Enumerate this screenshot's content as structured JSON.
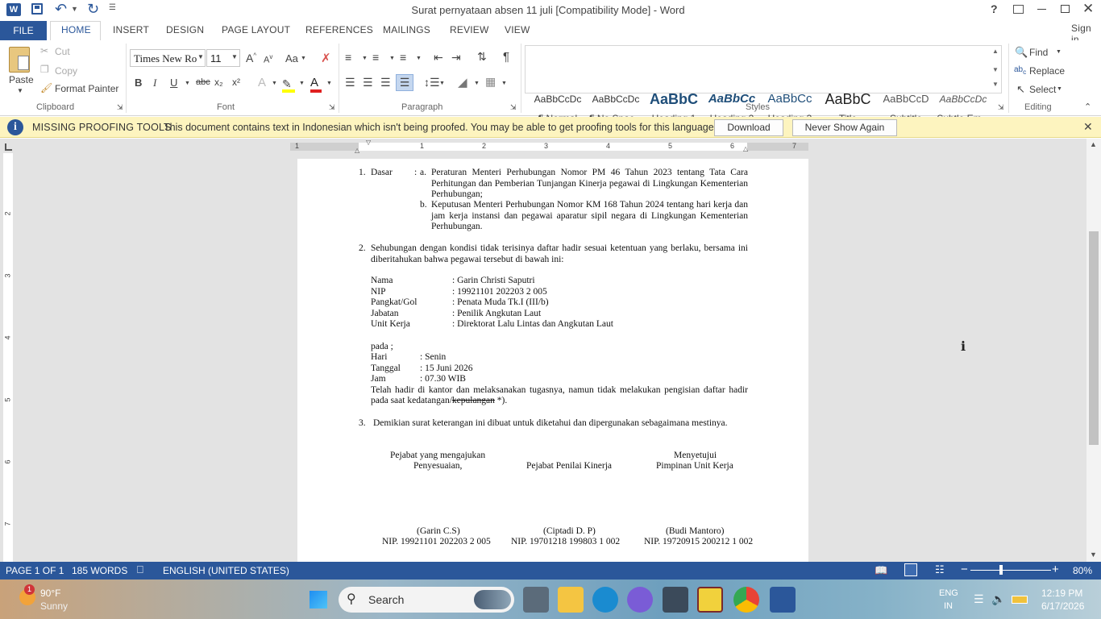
{
  "window": {
    "title": "Surat pernyataan absen 11 juli [Compatibility Mode] - Word",
    "help": "?"
  },
  "tabs": [
    "FILE",
    "HOME",
    "INSERT",
    "DESIGN",
    "PAGE LAYOUT",
    "REFERENCES",
    "MAILINGS",
    "REVIEW",
    "VIEW"
  ],
  "sign_in": "Sign in",
  "clipboard": {
    "paste": "Paste",
    "cut": "Cut",
    "copy": "Copy",
    "format_painter": "Format Painter",
    "label": "Clipboard"
  },
  "font": {
    "name": "Times New Ro",
    "size": "11",
    "label": "Font",
    "case": "Aa",
    "bold": "B",
    "italic": "I",
    "underline": "U",
    "strike": "abc",
    "sub": "x₂",
    "sup": "x²",
    "effects": "A",
    "color": "A"
  },
  "paragraph": {
    "label": "Paragraph",
    "pilcrow": "¶"
  },
  "styles": {
    "label": "Styles",
    "items": [
      {
        "preview": "AaBbCcDc",
        "name": "¶ Normal"
      },
      {
        "preview": "AaBbCcDc",
        "name": "¶ No Spac..."
      },
      {
        "preview": "AaBbC",
        "name": "Heading 1"
      },
      {
        "preview": "AaBbCc",
        "name": "Heading 2"
      },
      {
        "preview": "AaBbCc",
        "name": "Heading 3"
      },
      {
        "preview": "AaBbC",
        "name": "Title"
      },
      {
        "preview": "AaBbCcD",
        "name": "Subtitle"
      },
      {
        "preview": "AaBbCcDc",
        "name": "Subtle Em..."
      }
    ]
  },
  "editing": {
    "label": "Editing",
    "find": "Find",
    "replace": "Replace",
    "select": "Select"
  },
  "infobar": {
    "title": "MISSING PROOFING TOOLS",
    "message": "This document contains text in Indonesian which isn't being proofed. You may be able to get proofing tools for this language.",
    "download": "Download",
    "never": "Never Show Again"
  },
  "ruler": {
    "h": [
      "1",
      "1",
      "2",
      "3",
      "4",
      "5",
      "6",
      "7"
    ],
    "v": [
      "2",
      "3",
      "4",
      "5",
      "6",
      "7"
    ]
  },
  "doc": {
    "p1_num": "1.",
    "p1_label": "Dasar",
    "colon": ":",
    "p1a_l": "a.",
    "p1a": "Peraturan Menteri Perhubungan Nomor PM  46 Tahun 2023 tentang Tata Cara Perhitungan dan Pemberian Tunjangan Kinerja pegawai di Lingkungan Kementerian Perhubungan;",
    "p1b_l": "b.",
    "p1b": "Keputusan Menteri Perhubungan Nomor KM 168 Tahun 2024 tentang hari kerja dan jam kerja instansi dan pegawai aparatur sipil negara di Lingkungan Kementerian Perhubungan.",
    "p2_num": "2.",
    "p2": "Sehubungan dengan kondisi tidak terisinya daftar hadir sesuai ketentuan yang berlaku, bersama ini diberitahukan bahwa pegawai tersebut di bawah ini:",
    "fields": [
      {
        "k": "Nama",
        "v": ": Garin Christi Saputri"
      },
      {
        "k": "NIP",
        "v": ": 19921101 202203 2 005"
      },
      {
        "k": "Pangkat/Gol",
        "v": ": Penata Muda Tk.I (III/b)"
      },
      {
        "k": "Jabatan",
        "v": ": Penilik Angkutan Laut"
      },
      {
        "k": "Unit Kerja",
        "v": ": Direktorat Lalu Lintas dan Angkutan Laut"
      }
    ],
    "pada": "pada ;",
    "times": [
      {
        "k": "Hari",
        "v": ": Senin"
      },
      {
        "k": "Tanggal",
        "v": ": 15 Juni 2026"
      },
      {
        "k": "Jam",
        "v": ": 07.30 WIB"
      }
    ],
    "telah": "Telah hadir di kantor dan melaksanakan tugasnya, namun tidak melakukan pengisian daftar hadir",
    "pada_saat": "pada saat kedatangan/",
    "kepulangan": "kepulangan",
    "tail": " *).",
    "p3_num": "3.",
    "p3": "Demikian surat keterangan ini dibuat untuk diketahui dan dipergunakan sebagaimana mestinya.",
    "sig1_a": "Pejabat yang mengajukan",
    "sig1_b": "Penyesuaian,",
    "sig2": "Pejabat Penilai Kinerja",
    "sig3_a": "Menyetujui",
    "sig3_b": "Pimpinan Unit Kerja",
    "n1": "(Garin C.S)",
    "n2": "(Ciptadi D. P)",
    "n3": "(Budi Mantoro)",
    "nip1": "NIP. 19921101 202203 2 005",
    "nip2": "NIP. 19701218 199803 1 002",
    "nip3": "NIP. 19720915 200212 1 002"
  },
  "status": {
    "page": "PAGE 1 OF 1",
    "words": "185 WORDS",
    "lang": "ENGLISH (UNITED STATES)",
    "zoom": "80%"
  },
  "taskbar": {
    "temp": "90°F",
    "weather": "Sunny",
    "badge": "1",
    "search": "Search",
    "lang1": "ENG",
    "lang2": "IN",
    "time": "12:19 PM",
    "date": "6/17/2026"
  },
  "colors": {
    "accent": "#2b579a",
    "infobar": "#fdf4bf"
  }
}
